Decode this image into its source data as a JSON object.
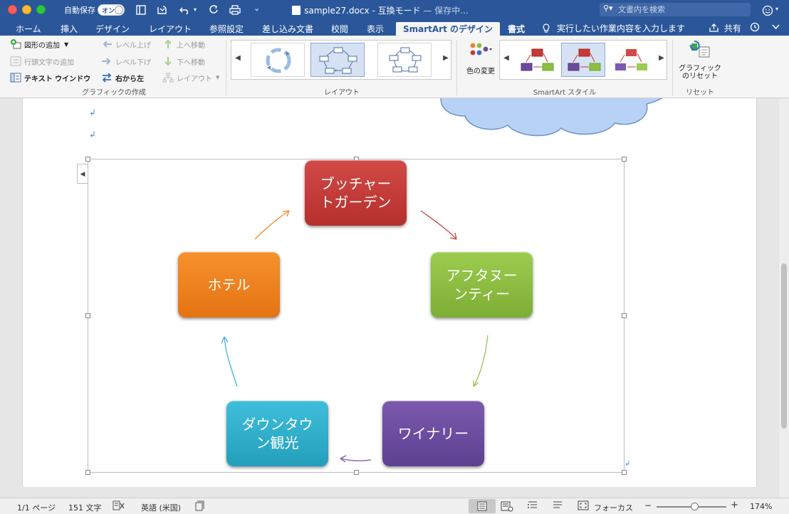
{
  "titlebar": {
    "autosave_label": "自動保存",
    "autosave_state": "オン",
    "doc_name": "sample27.docx",
    "separator": "-",
    "mode": "互換モード",
    "status": "— 保存中...",
    "search_placeholder": "文書内を検索"
  },
  "tabs": {
    "home": "ホーム",
    "insert": "挿入",
    "design": "デザイン",
    "layout": "レイアウト",
    "references": "参照設定",
    "mailings": "差し込み文書",
    "review": "校閲",
    "view": "表示",
    "smartart_design": "SmartArt のデザイン",
    "format": "書式",
    "tell_me": "実行したい作業内容を入力します",
    "share": "共有"
  },
  "ribbon": {
    "add_shape": "図形の追加",
    "add_bullet": "行頭文字の追加",
    "text_pane": "テキスト ウインドウ",
    "promote": "レベル上げ",
    "demote": "レベル下げ",
    "right_to_left": "右から左",
    "move_up": "上へ移動",
    "move_down": "下へ移動",
    "layout_btn": "レイアウト",
    "group_create": "グラフィックの作成",
    "group_layouts": "レイアウト",
    "change_colors": "色の変更",
    "group_styles": "SmartArt スタイル",
    "reset_graphic_line1": "グラフィック",
    "reset_graphic_line2": "のリセット",
    "group_reset": "リセット"
  },
  "smartart": {
    "nodes": [
      {
        "line1": "ブッチャー",
        "line2": "トガーデン",
        "color": "#c43a37"
      },
      {
        "line1": "アフタヌー",
        "line2": "ンティー",
        "color": "#8cbf3f"
      },
      {
        "line1": "ワイナリー",
        "line2": "",
        "color": "#6b4a9e"
      },
      {
        "line1": "ダウンタウ",
        "line2": "ン観光",
        "color": "#2eb0cc"
      },
      {
        "line1": "ホテル",
        "line2": "",
        "color": "#f0821e"
      }
    ]
  },
  "statusbar": {
    "page": "1/1 ページ",
    "words": "151 文字",
    "language": "英語 (米国)",
    "focus": "フォーカス",
    "zoom_minus": "−",
    "zoom_plus": "+",
    "zoom": "174%",
    "zoom_level": 0.55
  },
  "colors": {
    "title_blue": "#2b579a",
    "ribbon_bg": "#f5f5f5"
  }
}
